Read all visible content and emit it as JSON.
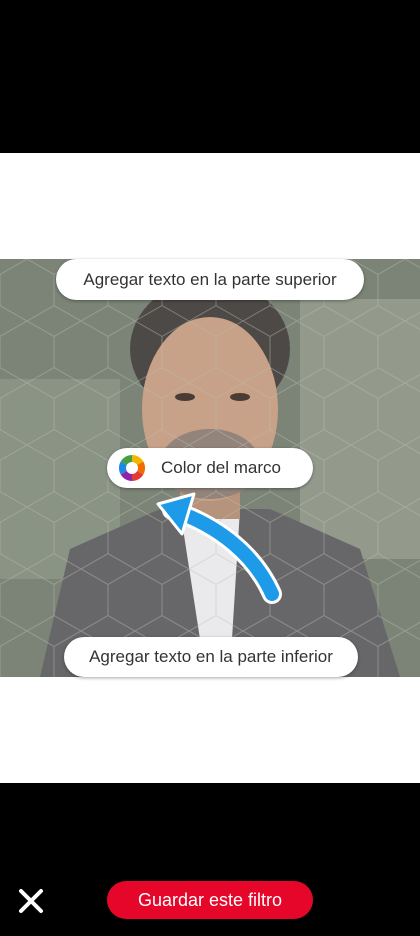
{
  "editor": {
    "top_text_placeholder": "Agregar texto en la parte superior",
    "bottom_text_placeholder": "Agregar texto en la parte inferior",
    "frame_color_label": "Color del marco"
  },
  "actions": {
    "save_label": "Guardar este filtro",
    "close_icon": "close-icon"
  },
  "colors": {
    "accent": "#e5062a",
    "arrow": "#1e9be8"
  }
}
